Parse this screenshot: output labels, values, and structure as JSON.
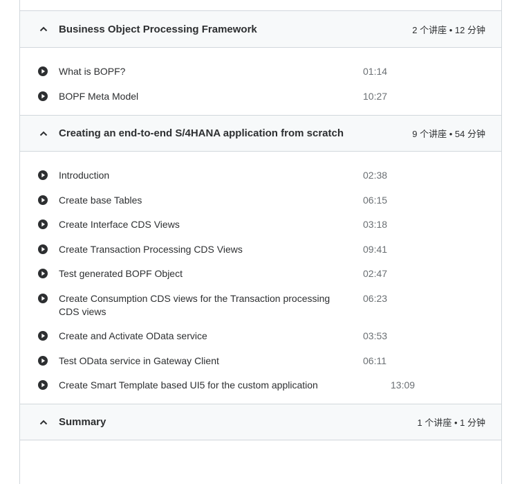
{
  "sections": [
    {
      "title": "Business Object Processing Framework",
      "meta": "2 个讲座 • 12 分钟",
      "lectures": [
        {
          "title": "What is BOPF?",
          "time": "01:14"
        },
        {
          "title": "BOPF Meta Model",
          "time": "10:27"
        }
      ]
    },
    {
      "title": "Creating an end-to-end S/4HANA application from scratch",
      "meta": "9 个讲座 • 54 分钟",
      "lectures": [
        {
          "title": "Introduction",
          "time": "02:38"
        },
        {
          "title": "Create base Tables",
          "time": "06:15"
        },
        {
          "title": "Create Interface CDS Views",
          "time": "03:18"
        },
        {
          "title": "Create Transaction Processing CDS Views",
          "time": "09:41"
        },
        {
          "title": "Test generated BOPF Object",
          "time": "02:47"
        },
        {
          "title": "Create Consumption CDS views for the Transaction processing CDS views",
          "time": "06:23"
        },
        {
          "title": "Create and Activate OData service",
          "time": "03:53"
        },
        {
          "title": "Test OData service in Gateway Client",
          "time": "06:11"
        },
        {
          "title": "Create Smart Template based UI5 for the custom application",
          "time": "13:09"
        }
      ]
    },
    {
      "title": "Summary",
      "meta": "1 个讲座 • 1 分钟",
      "lectures": []
    }
  ],
  "icons": {
    "section_toggle": "chevron-up-icon",
    "lecture": "play-circle-icon"
  }
}
